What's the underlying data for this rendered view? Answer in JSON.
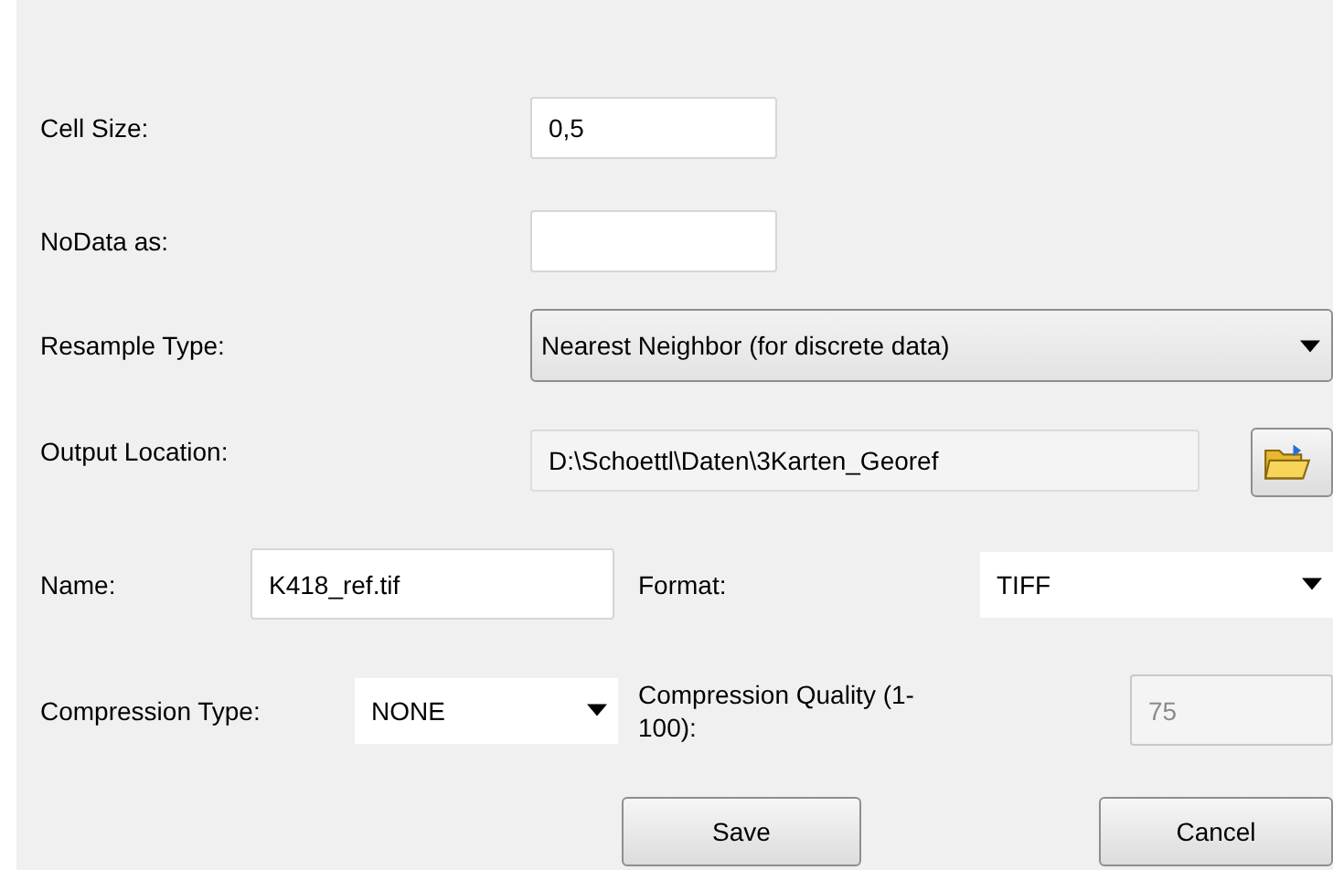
{
  "cell_size": {
    "label": "Cell Size:",
    "value": "0,5"
  },
  "nodata": {
    "label": "NoData as:"
  },
  "resample_type": {
    "label": "Resample Type:",
    "value": "Nearest Neighbor (for discrete data)"
  },
  "output_location": {
    "label": "Output Location:",
    "value": "D:\\Schoettl\\Daten\\3Karten_Georef",
    "readonly": true
  },
  "name": {
    "label": "Name:",
    "value": "K418_ref.tif"
  },
  "format": {
    "label": "Format:",
    "value": "TIFF"
  },
  "compression_type": {
    "label": "Compression Type:",
    "value": "NONE"
  },
  "compression_quality": {
    "label": "Compression Quality (1-100):",
    "value": "75",
    "disabled": true
  },
  "buttons": [
    {
      "label": "Save"
    },
    {
      "label": "Cancel"
    }
  ]
}
